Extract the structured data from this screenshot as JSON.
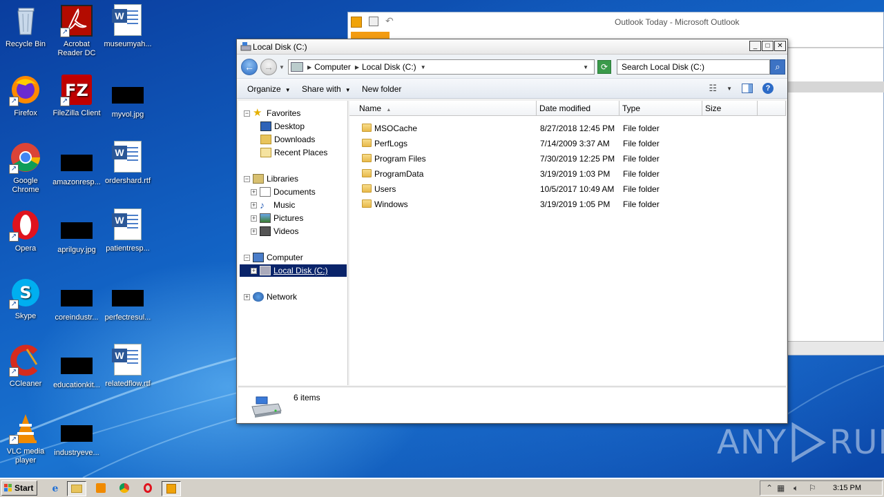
{
  "desktop": {
    "icons": [
      {
        "label": "Recycle Bin"
      },
      {
        "label": "Acrobat Reader DC"
      },
      {
        "label": "museumyah..."
      },
      {
        "label": "Firefox"
      },
      {
        "label": "FileZilla Client"
      },
      {
        "label": "myvol.jpg"
      },
      {
        "label": "Google Chrome"
      },
      {
        "label": "amazonresp..."
      },
      {
        "label": "ordershard.rtf"
      },
      {
        "label": "Opera"
      },
      {
        "label": "aprilguy.jpg"
      },
      {
        "label": "patientresp..."
      },
      {
        "label": "Skype"
      },
      {
        "label": "coreindustr..."
      },
      {
        "label": "perfectresul..."
      },
      {
        "label": "CCleaner"
      },
      {
        "label": "educationkit..."
      },
      {
        "label": "relatedflow.rtf"
      },
      {
        "label": "VLC media player"
      },
      {
        "label": "industryeve..."
      }
    ]
  },
  "outlook": {
    "title": "Outlook Today - Microsoft Outlook"
  },
  "explorer": {
    "title": "Local Disk (C:)",
    "address": {
      "segments": [
        "Computer",
        "Local Disk (C:)"
      ]
    },
    "search_placeholder": "Search Local Disk (C:)",
    "toolbar": {
      "organize": "Organize",
      "share_with": "Share with",
      "new_folder": "New folder"
    },
    "nav": {
      "favorites": "Favorites",
      "desktop": "Desktop",
      "downloads": "Downloads",
      "recent_places": "Recent Places",
      "libraries": "Libraries",
      "documents": "Documents",
      "music": "Music",
      "pictures": "Pictures",
      "videos": "Videos",
      "computer": "Computer",
      "local_disk": "Local Disk (C:)",
      "network": "Network"
    },
    "columns": {
      "name": "Name",
      "date_modified": "Date modified",
      "type": "Type",
      "size": "Size"
    },
    "files": [
      {
        "name": "MSOCache",
        "date": "8/27/2018 12:45 PM",
        "type": "File folder"
      },
      {
        "name": "PerfLogs",
        "date": "7/14/2009 3:37 AM",
        "type": "File folder"
      },
      {
        "name": "Program Files",
        "date": "7/30/2019 12:25 PM",
        "type": "File folder"
      },
      {
        "name": "ProgramData",
        "date": "3/19/2019 1:03 PM",
        "type": "File folder"
      },
      {
        "name": "Users",
        "date": "10/5/2017 10:49 AM",
        "type": "File folder"
      },
      {
        "name": "Windows",
        "date": "3/19/2019 1:05 PM",
        "type": "File folder"
      }
    ],
    "status": "6 items"
  },
  "watermark": {
    "left": "ANY",
    "right": "RUN"
  },
  "taskbar": {
    "start": "Start",
    "clock": "3:15 PM"
  }
}
